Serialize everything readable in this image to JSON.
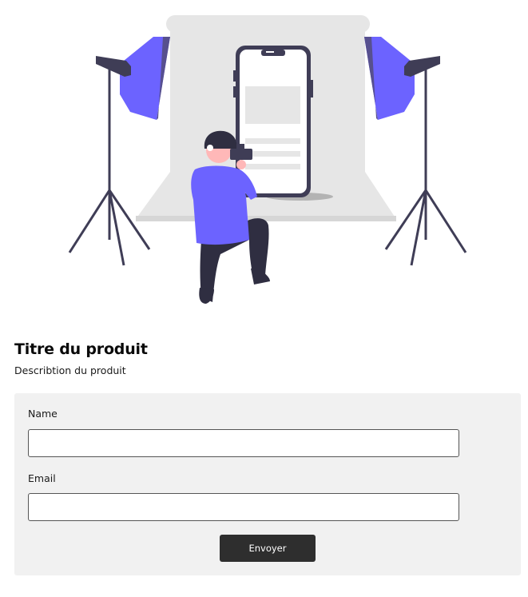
{
  "illustration": {
    "name": "photographer-product-shoot-illustration",
    "colors": {
      "accent": "#6c63ff",
      "backdrop": "#e6e6e6",
      "dark": "#3f3d56",
      "pants": "#2f2e41",
      "skin": "#ffb8b8"
    }
  },
  "product": {
    "title": "Titre du produit",
    "description": "Describtion du produit"
  },
  "form": {
    "name_label": "Name",
    "name_value": "",
    "email_label": "Email",
    "email_value": "",
    "submit_label": "Envoyer"
  }
}
